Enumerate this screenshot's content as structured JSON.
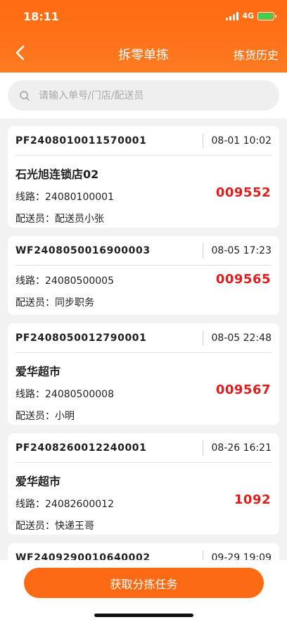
{
  "status_bar": {
    "time": "18:11",
    "network": "4G"
  },
  "nav": {
    "title": "拆零单拣",
    "right_label": "拣货历史"
  },
  "search": {
    "placeholder": "请输入单号/门店/配送员",
    "value": ""
  },
  "labels": {
    "line_prefix": "线路：",
    "driver_prefix": "配送员："
  },
  "orders": [
    {
      "order_no": "PF2408010011570001",
      "date": "08-01 10:02",
      "store": "石光旭连锁店02",
      "line": "24080100001",
      "code": "009552",
      "driver": "配送员小张"
    },
    {
      "order_no": "WF2408050016900003",
      "date": "08-05 17:23",
      "store": "",
      "line": "24080500005",
      "code": "009565",
      "driver": "同步职务"
    },
    {
      "order_no": "PF2408050012790001",
      "date": "08-05 22:48",
      "store": "爱华超市",
      "line": "24080500008",
      "code": "009567",
      "driver": "小明"
    },
    {
      "order_no": "PF2408260012240001",
      "date": "08-26 16:21",
      "store": "爱华超市",
      "line": "24082600012",
      "code": "1092",
      "driver": "快递王哥"
    },
    {
      "order_no": "WF2409290010640002",
      "date": "09-29 19:09",
      "store": "",
      "line": "",
      "code": "",
      "driver": ""
    }
  ],
  "bottom": {
    "button_label": "获取分拣任务"
  },
  "colors": {
    "brand_orange": "#fd6a14",
    "code_red": "#e01c1c",
    "background": "#f2f2f2"
  }
}
